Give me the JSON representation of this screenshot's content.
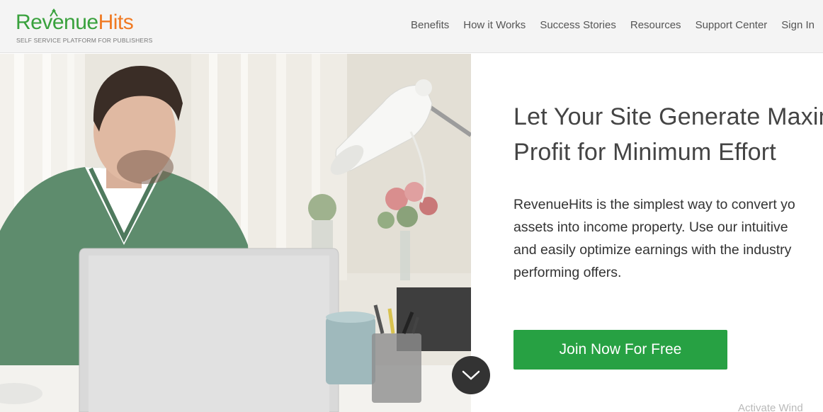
{
  "brand": {
    "name_part1": "Revenue",
    "name_part2": "Hits",
    "tagline": "SELF SERVICE PLATFORM FOR PUBLISHERS",
    "colors": {
      "green": "#39a13d",
      "orange": "#f07a23"
    }
  },
  "nav": {
    "items": [
      {
        "label": "Benefits"
      },
      {
        "label": "How it Works"
      },
      {
        "label": "Success Stories"
      },
      {
        "label": "Resources"
      },
      {
        "label": "Support Center"
      },
      {
        "label": "Sign In"
      }
    ]
  },
  "hero": {
    "headline_line1": "Let Your Site Generate Maxim",
    "headline_line2": "Profit for Minimum Effort",
    "description_lines": [
      "RevenueHits is the simplest way to convert yo",
      "assets into income property. Use our intuitive",
      "and easily optimize earnings with the industry",
      "performing offers."
    ],
    "cta_label": "Join Now For Free",
    "cta_color": "#27a143",
    "scroll_icon": "chevron-down-icon"
  },
  "overlay": {
    "watermark": "Activate Wind"
  }
}
